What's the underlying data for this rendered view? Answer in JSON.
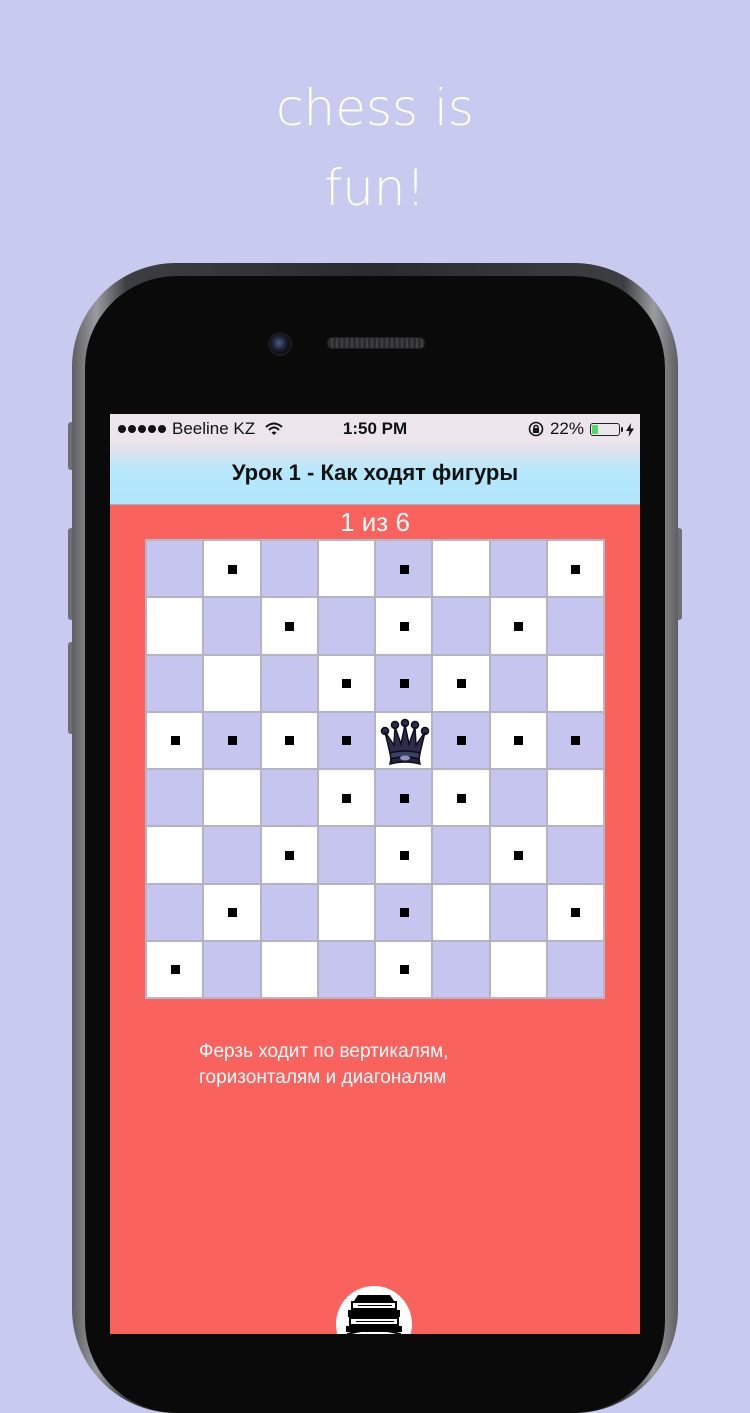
{
  "promo": {
    "line1": "chess is",
    "line2": "fun!"
  },
  "status_bar": {
    "carrier": "Beeline KZ",
    "time": "1:50 PM",
    "battery_percent": "22%",
    "battery_level": 0.22
  },
  "nav": {
    "title": "Урок 1 - Как ходят фигуры"
  },
  "lesson": {
    "counter": "1 из 6",
    "description_line1": "Ферзь ходит по вертикалям,",
    "description_line2": "горизонталям и диагоналям"
  },
  "board": {
    "size": 8,
    "queen": {
      "row": 3,
      "col": 4,
      "icon": "queen-icon"
    },
    "moves": [
      [
        0,
        1
      ],
      [
        0,
        4
      ],
      [
        0,
        7
      ],
      [
        1,
        2
      ],
      [
        1,
        4
      ],
      [
        1,
        6
      ],
      [
        2,
        3
      ],
      [
        2,
        4
      ],
      [
        2,
        5
      ],
      [
        3,
        0
      ],
      [
        3,
        1
      ],
      [
        3,
        2
      ],
      [
        3,
        3
      ],
      [
        3,
        5
      ],
      [
        3,
        6
      ],
      [
        3,
        7
      ],
      [
        4,
        3
      ],
      [
        4,
        4
      ],
      [
        4,
        5
      ],
      [
        5,
        2
      ],
      [
        5,
        4
      ],
      [
        5,
        6
      ],
      [
        6,
        1
      ],
      [
        6,
        4
      ],
      [
        6,
        7
      ],
      [
        7,
        0
      ],
      [
        7,
        4
      ]
    ],
    "colors": {
      "light": "#ffffff",
      "dark": "#c5c5f0"
    }
  },
  "colors": {
    "page_background": "#c9caf0",
    "screen_background": "#fa625e",
    "nav_gradient_end": "#b1e6fb"
  },
  "icons": {
    "wifi": "wifi-icon",
    "rotation_lock": "rotation-lock-icon",
    "charging": "bolt-icon",
    "books": "books-icon"
  }
}
